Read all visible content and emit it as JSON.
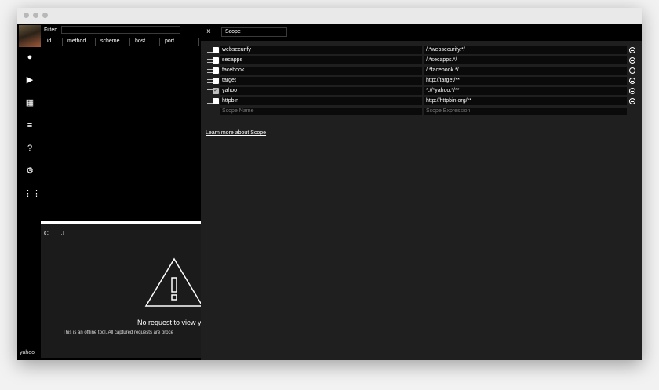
{
  "window": {
    "filter_label": "Filter:",
    "columns": [
      "id",
      "method",
      "scheme",
      "host",
      "port"
    ],
    "status_text": "yahoo"
  },
  "sidebar": {
    "icons": [
      "record-icon",
      "play-icon",
      "dashboard-icon",
      "sort-icon",
      "help-icon",
      "settings-icon",
      "apps-icon"
    ]
  },
  "request_panel": {
    "tabs_text": "C J",
    "empty_title": "No request to view y",
    "empty_subtitle": "This is an offline tool. All captured requests are proce"
  },
  "scope": {
    "close_label": "×",
    "selector_value": "Scope",
    "rules": [
      {
        "name": "websecurify",
        "expression": "/.*websecurify.*/",
        "checked": false
      },
      {
        "name": "secapps",
        "expression": "/.*secapps.*/",
        "checked": false
      },
      {
        "name": "facebook",
        "expression": "/.*facebook.*/",
        "checked": false
      },
      {
        "name": "target",
        "expression": "http://target/**",
        "checked": false
      },
      {
        "name": "yahoo",
        "expression": "*://*yahoo.*/**",
        "checked": true
      },
      {
        "name": "httpbin",
        "expression": "http://httpbin.org/**",
        "checked": false
      }
    ],
    "name_placeholder": "Scope Name",
    "expression_placeholder": "Scope Expression",
    "learn_more": "Learn more about Scope"
  },
  "colors": {
    "background": "#000000",
    "panel": "#1f1f1f",
    "accent": "#ffffff"
  }
}
